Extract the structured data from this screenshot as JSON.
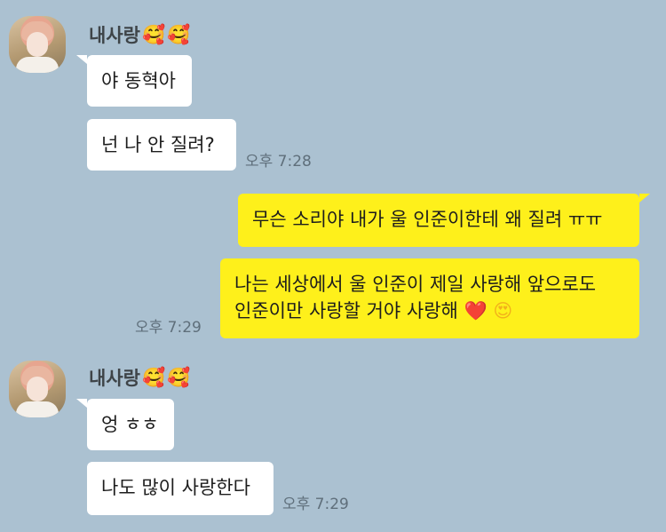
{
  "header_sender": {
    "name": "내사랑",
    "emojis": [
      "🥰",
      "🥰"
    ]
  },
  "messages": {
    "m1": "야 동혁아",
    "m2": "넌 나 안 질려?",
    "t1": "오후 7:28",
    "m3": "무슨 소리야 내가 울 인준이한테 왜 질려 ㅠㅠ",
    "m4_line1": "나는 세상에서 울 인준이 제일 사랑해 앞으로도",
    "m4_line2": "인준이만 사랑할 거야 사랑해",
    "m4_emojis": [
      "❤️",
      "😍"
    ],
    "t2": "오후 7:29",
    "m5": "엉 ㅎㅎ",
    "m6": "나도 많이 사랑한다",
    "t3": "오후 7:29"
  },
  "colors": {
    "background": "#abc1d1",
    "incoming_bubble": "#ffffff",
    "outgoing_bubble": "#fef01b"
  }
}
